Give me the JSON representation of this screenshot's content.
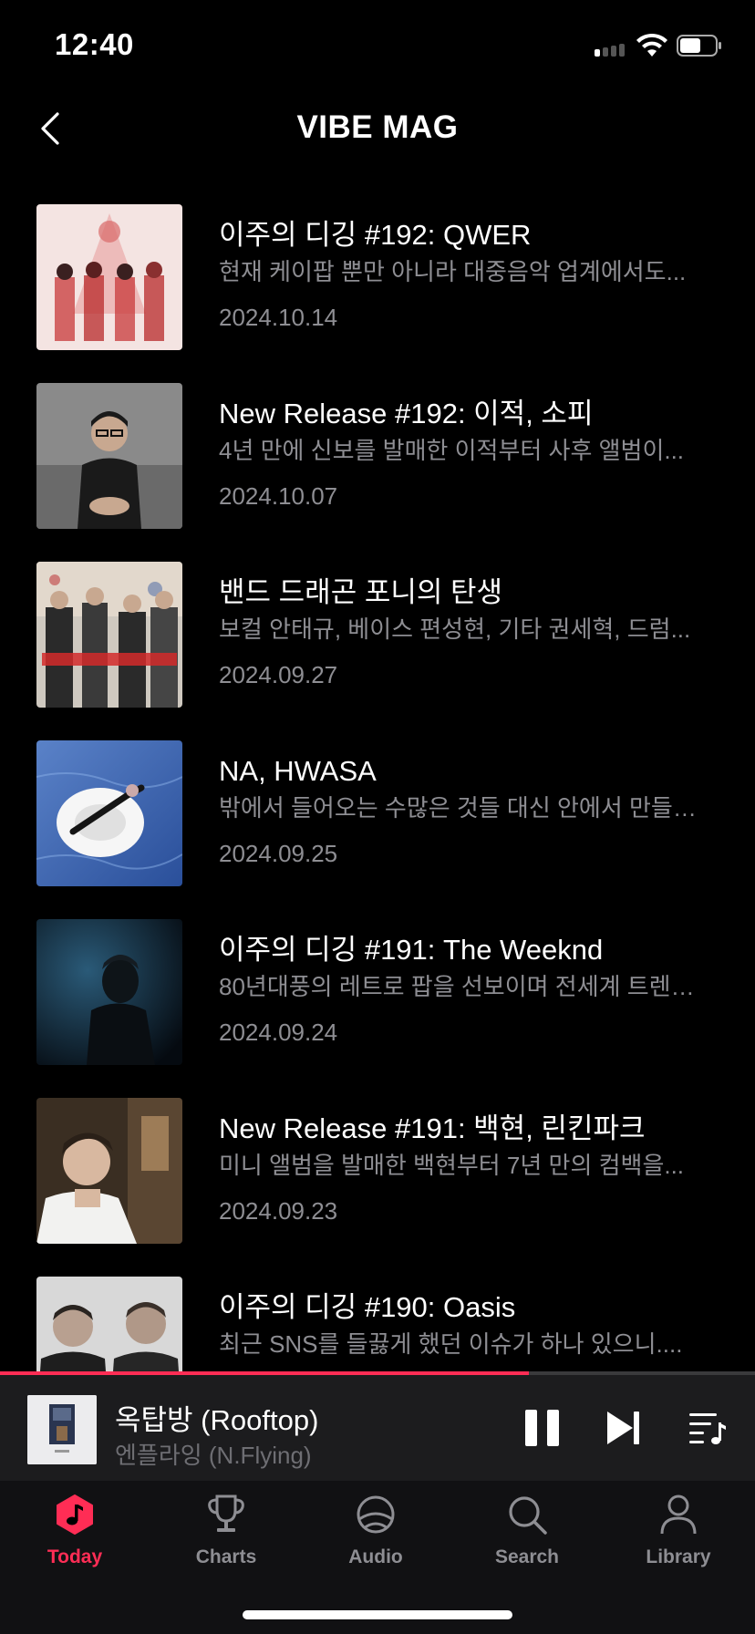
{
  "status_bar": {
    "time": "12:40"
  },
  "header": {
    "title": "VIBE MAG"
  },
  "articles": [
    {
      "title": "이주의 디깅 #192: QWER",
      "description": "현재 케이팝 뿐만 아니라 대중음악 업계에서도...",
      "date": "2024.10.14"
    },
    {
      "title": "New Release #192: 이적, 소피",
      "description": "4년 만에 신보를 발매한 이적부터 사후 앨범이...",
      "date": "2024.10.07"
    },
    {
      "title": "밴드 드래곤 포니의 탄생",
      "description": "보컬 안태규, 베이스 편성현, 기타 권세혁, 드럼...",
      "date": "2024.09.27"
    },
    {
      "title": "NA, HWASA",
      "description": "밖에서 들어오는 수많은 것들 대신 안에서 만들…",
      "date": "2024.09.25"
    },
    {
      "title": "이주의 디깅 #191: The Weeknd",
      "description": "80년대풍의 레트로 팝을 선보이며 전세계 트렌…",
      "date": "2024.09.24"
    },
    {
      "title": "New Release #191: 백현, 린킨파크",
      "description": "미니 앨범을 발매한 백현부터 7년 만의 컴백을...",
      "date": "2024.09.23"
    },
    {
      "title": "이주의 디깅 #190: Oasis",
      "description": "최근 SNS를 들끓게 했던 이슈가 하나 있으니....",
      "date": ""
    }
  ],
  "player": {
    "progress": 0.7,
    "title": "옥탑방 (Rooftop)",
    "artist": "엔플라잉 (N.Flying)"
  },
  "tabs": [
    {
      "label": "Today",
      "icon": "music-note-icon",
      "active": true
    },
    {
      "label": "Charts",
      "icon": "trophy-icon",
      "active": false
    },
    {
      "label": "Audio",
      "icon": "podcast-icon",
      "active": false
    },
    {
      "label": "Search",
      "icon": "search-icon",
      "active": false
    },
    {
      "label": "Library",
      "icon": "person-icon",
      "active": false
    }
  ],
  "colors": {
    "accent": "#ff2d55",
    "background": "#000000",
    "secondary_text": "#8e8e93"
  }
}
